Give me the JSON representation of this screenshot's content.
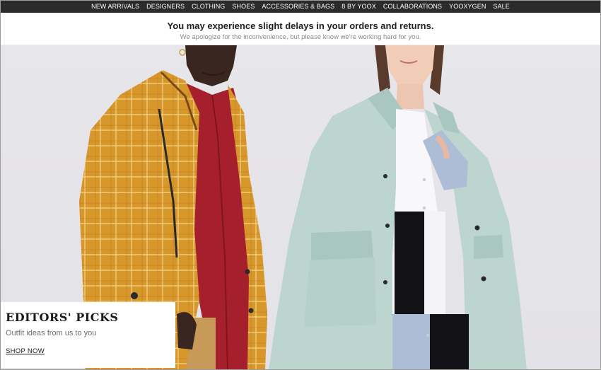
{
  "nav": {
    "items": [
      {
        "label": "NEW ARRIVALS"
      },
      {
        "label": "DESIGNERS"
      },
      {
        "label": "CLOTHING"
      },
      {
        "label": "SHOES"
      },
      {
        "label": "ACCESSORIES & BAGS"
      },
      {
        "label": "8 BY YOOX"
      },
      {
        "label": "COLLABORATIONS"
      },
      {
        "label": "YOOXYGEN"
      },
      {
        "label": "SALE"
      }
    ]
  },
  "notice": {
    "headline": "You may experience slight delays in your orders and returns.",
    "subtext": "We apologize for the inconvenience, but please know we're working hard for you."
  },
  "promo": {
    "title": "EDITORS' PICKS",
    "subtitle": "Outfit ideas from us to you",
    "cta": "SHOP NOW"
  },
  "colors": {
    "nav_bg": "#2b2b2b",
    "hero_bg": "#e7e6ea",
    "plaid_coat": "#d99a2b",
    "red_shirt": "#a3202e",
    "mint_coat": "#bcd6cf"
  }
}
